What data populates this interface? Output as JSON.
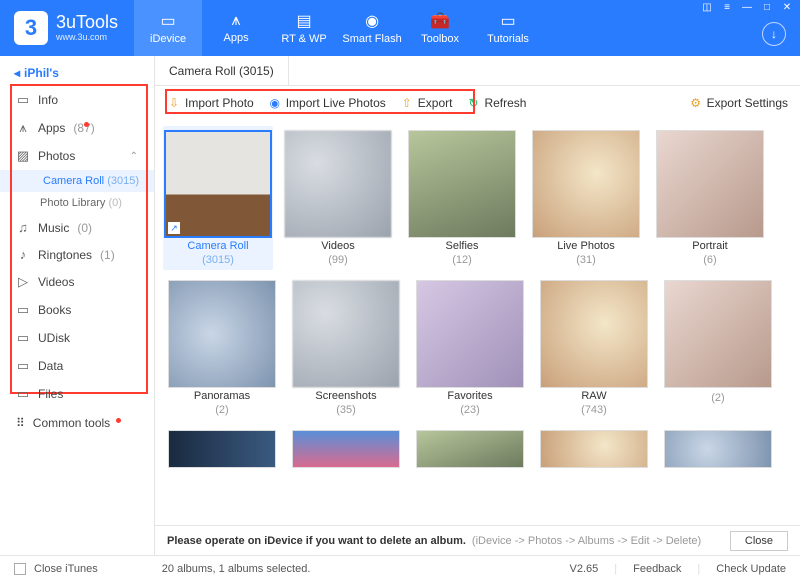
{
  "app": {
    "brand": "3uTools",
    "url": "www.3u.com",
    "logo_char": "3"
  },
  "topnav": [
    "iDevice",
    "Apps",
    "RT & WP",
    "Smart Flash",
    "Toolbox",
    "Tutorials"
  ],
  "sidebar": {
    "device": "iPhil's",
    "info": "Info",
    "apps": {
      "label": "Apps",
      "count": "(87)"
    },
    "photos": "Photos",
    "camera_roll": {
      "label": "Camera Roll",
      "count": "(3015)"
    },
    "photo_library": {
      "label": "Photo Library",
      "count": "(0)"
    },
    "music": {
      "label": "Music",
      "count": "(0)"
    },
    "ringtones": {
      "label": "Ringtones",
      "count": "(1)"
    },
    "videos": "Videos",
    "books": "Books",
    "udisk": "UDisk",
    "data": "Data",
    "files": "Files",
    "common_tools": "Common tools"
  },
  "tab": {
    "title": "Camera Roll (3015)"
  },
  "toolbar": {
    "import_photo": "Import Photo",
    "import_live": "Import Live Photos",
    "export": "Export",
    "refresh": "Refresh",
    "export_settings": "Export Settings"
  },
  "albums_row1": [
    {
      "name": "Camera Roll",
      "count": "(3015)",
      "selected": true,
      "badge": true
    },
    {
      "name": "Videos",
      "count": "(99)"
    },
    {
      "name": "Selfies",
      "count": "(12)"
    },
    {
      "name": "Live Photos",
      "count": "(31)"
    },
    {
      "name": "Portrait",
      "count": "(6)"
    }
  ],
  "albums_row2": [
    {
      "name": "Panoramas",
      "count": "(2)"
    },
    {
      "name": "Screenshots",
      "count": "(35)"
    },
    {
      "name": "Favorites",
      "count": "(23)"
    },
    {
      "name": "RAW",
      "count": "(743)"
    },
    {
      "name": "",
      "count": "(2)"
    }
  ],
  "hint": {
    "bold": "Please operate on iDevice if you want to delete an album.",
    "path": "(iDevice -> Photos -> Albums -> Edit -> Delete)",
    "close": "Close"
  },
  "footer": {
    "close_itunes": "Close iTunes",
    "status": "20 albums, 1 albums selected.",
    "version": "V2.65",
    "feedback": "Feedback",
    "check_update": "Check Update"
  }
}
